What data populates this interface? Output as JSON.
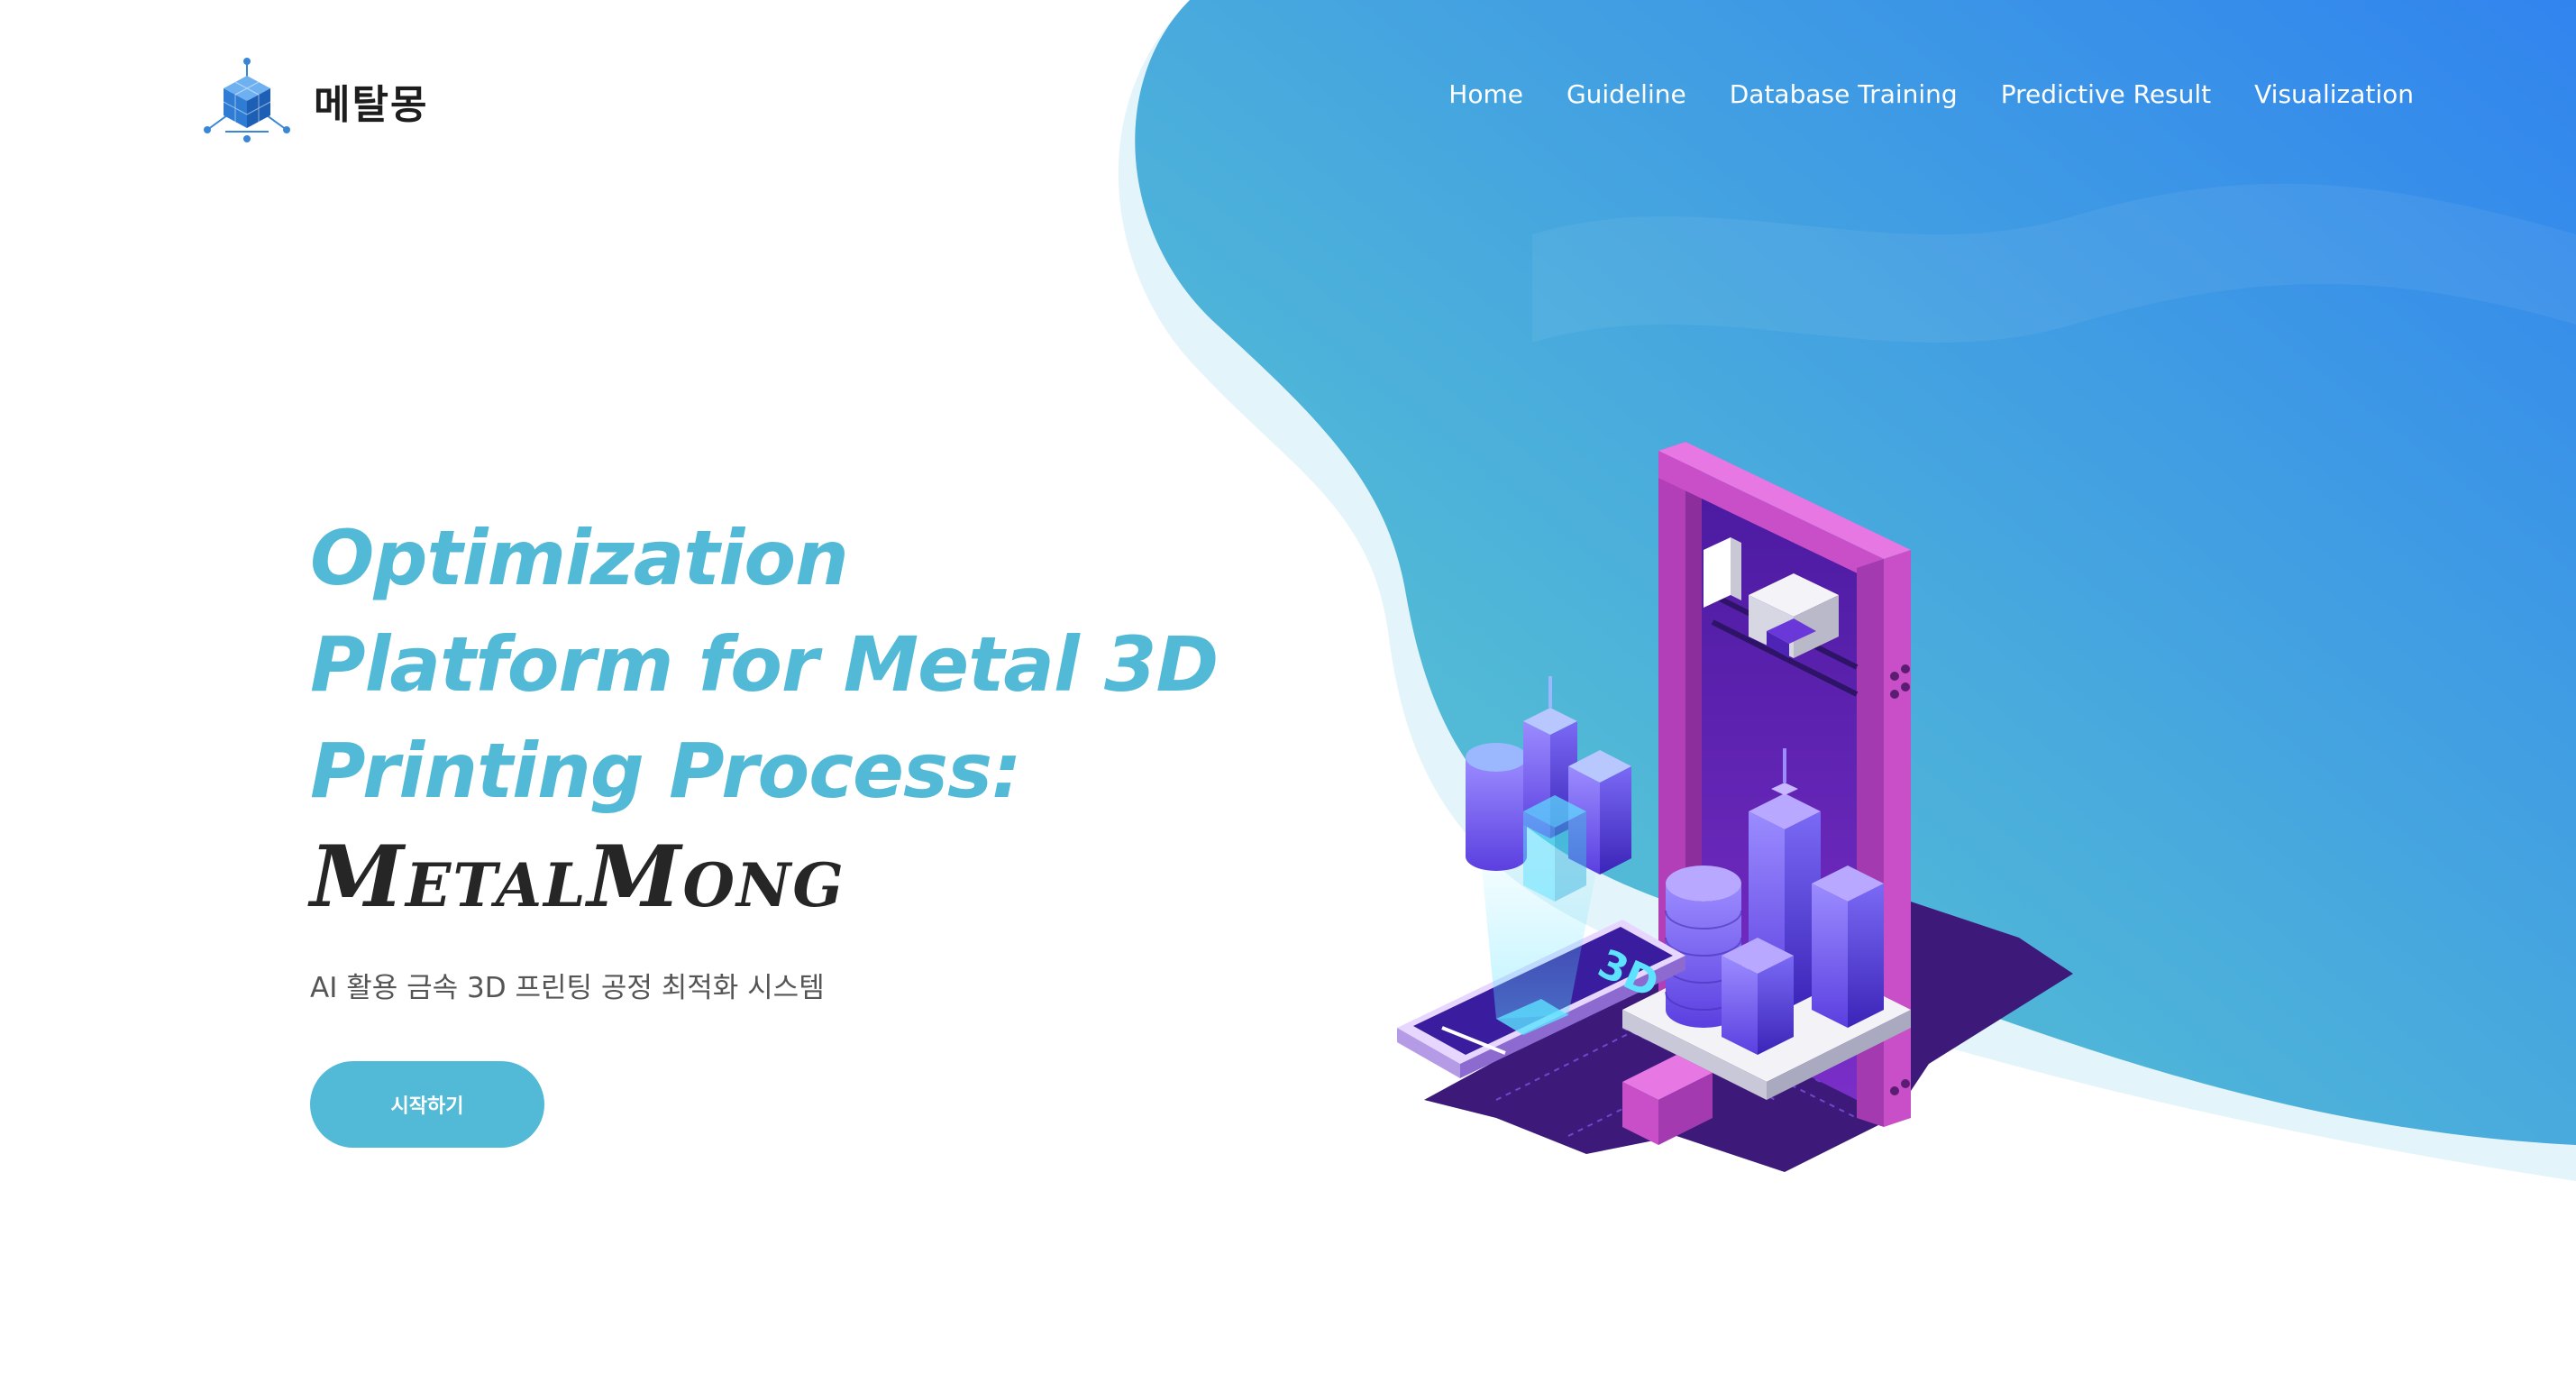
{
  "header": {
    "logo_text": "메탈몽",
    "nav": [
      {
        "label": "Home"
      },
      {
        "label": "Guideline"
      },
      {
        "label": "Database Training"
      },
      {
        "label": "Predictive Result"
      },
      {
        "label": "Visualization"
      }
    ]
  },
  "hero": {
    "title_line1": "Optimization",
    "title_line2": "Platform for Metal 3D",
    "title_line3": "Printing Process:",
    "brand": "MetalMong",
    "subtitle": "AI 활용 금속 3D 프린팅 공정 최적화 시스템",
    "cta_label": "시작하기"
  },
  "illustration": {
    "phone_label": "3D"
  },
  "colors": {
    "accent": "#52bad6",
    "gradient_start": "#52bad6",
    "gradient_end": "#3184ee",
    "printer_frame": "#c84fc8",
    "dark_text": "#262626"
  }
}
